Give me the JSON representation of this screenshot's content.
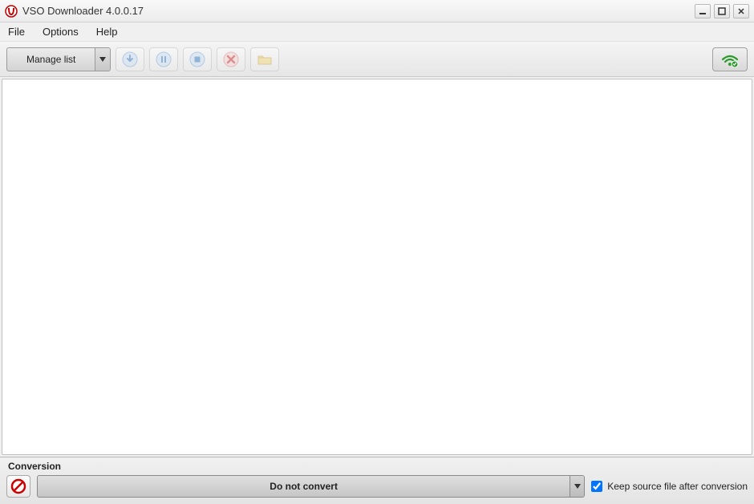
{
  "titlebar": {
    "title": "VSO Downloader 4.0.0.17"
  },
  "menubar": {
    "file": "File",
    "options": "Options",
    "help": "Help"
  },
  "toolbar": {
    "manage_list": "Manage list"
  },
  "conversion": {
    "section_label": "Conversion",
    "combo_label": "Do not convert",
    "keep_source_label": "Keep source file after conversion",
    "keep_source_checked": true
  }
}
